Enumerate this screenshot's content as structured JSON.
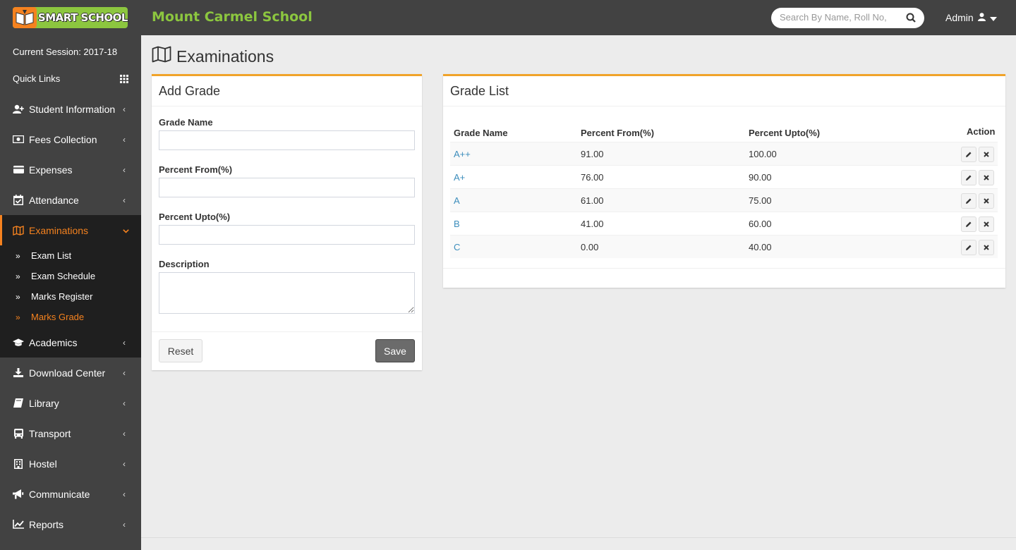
{
  "header": {
    "brand": "SMART SCHOOL",
    "school_name": "Mount Carmel School",
    "search_placeholder": "Search By Name, Roll No,",
    "user": "Admin"
  },
  "sidebar": {
    "session": "Current Session: 2017-18",
    "quick_links": "Quick Links",
    "items": [
      {
        "label": "Student Information",
        "icon": "user-plus-icon"
      },
      {
        "label": "Fees Collection",
        "icon": "money-icon"
      },
      {
        "label": "Expenses",
        "icon": "credit-card-icon"
      },
      {
        "label": "Attendance",
        "icon": "calendar-check-icon"
      },
      {
        "label": "Examinations",
        "icon": "map-icon"
      },
      {
        "label": "Academics",
        "icon": "graduation-cap-icon"
      },
      {
        "label": "Download Center",
        "icon": "download-icon"
      },
      {
        "label": "Library",
        "icon": "book-icon"
      },
      {
        "label": "Transport",
        "icon": "bus-icon"
      },
      {
        "label": "Hostel",
        "icon": "building-icon"
      },
      {
        "label": "Communicate",
        "icon": "bullhorn-icon"
      },
      {
        "label": "Reports",
        "icon": "line-chart-icon"
      }
    ],
    "sub_items": [
      {
        "label": "Exam List"
      },
      {
        "label": "Exam Schedule"
      },
      {
        "label": "Marks Register"
      },
      {
        "label": "Marks Grade"
      }
    ],
    "active_color": "#f5821f"
  },
  "page": {
    "title": "Examinations"
  },
  "add_grade": {
    "title": "Add Grade",
    "grade_name_label": "Grade Name",
    "percent_from_label": "Percent From(%)",
    "percent_upto_label": "Percent Upto(%)",
    "description_label": "Description",
    "grade_name_value": "",
    "percent_from_value": "",
    "percent_upto_value": "",
    "description_value": "",
    "reset_label": "Reset",
    "save_label": "Save"
  },
  "grade_list": {
    "title": "Grade List",
    "columns": [
      "Grade Name",
      "Percent From(%)",
      "Percent Upto(%)",
      "Action"
    ],
    "rows": [
      {
        "grade": "A++",
        "from": "91.00",
        "upto": "100.00"
      },
      {
        "grade": "A+",
        "from": "76.00",
        "upto": "90.00"
      },
      {
        "grade": "A",
        "from": "61.00",
        "upto": "75.00"
      },
      {
        "grade": "B",
        "from": "41.00",
        "upto": "60.00"
      },
      {
        "grade": "C",
        "from": "0.00",
        "upto": "40.00"
      }
    ]
  },
  "colors": {
    "topbar": "#424242",
    "brand_green": "#8cc63f",
    "accent_orange": "#f5821f",
    "box_border": "#f0a32a",
    "link_blue": "#3c8dbc"
  }
}
